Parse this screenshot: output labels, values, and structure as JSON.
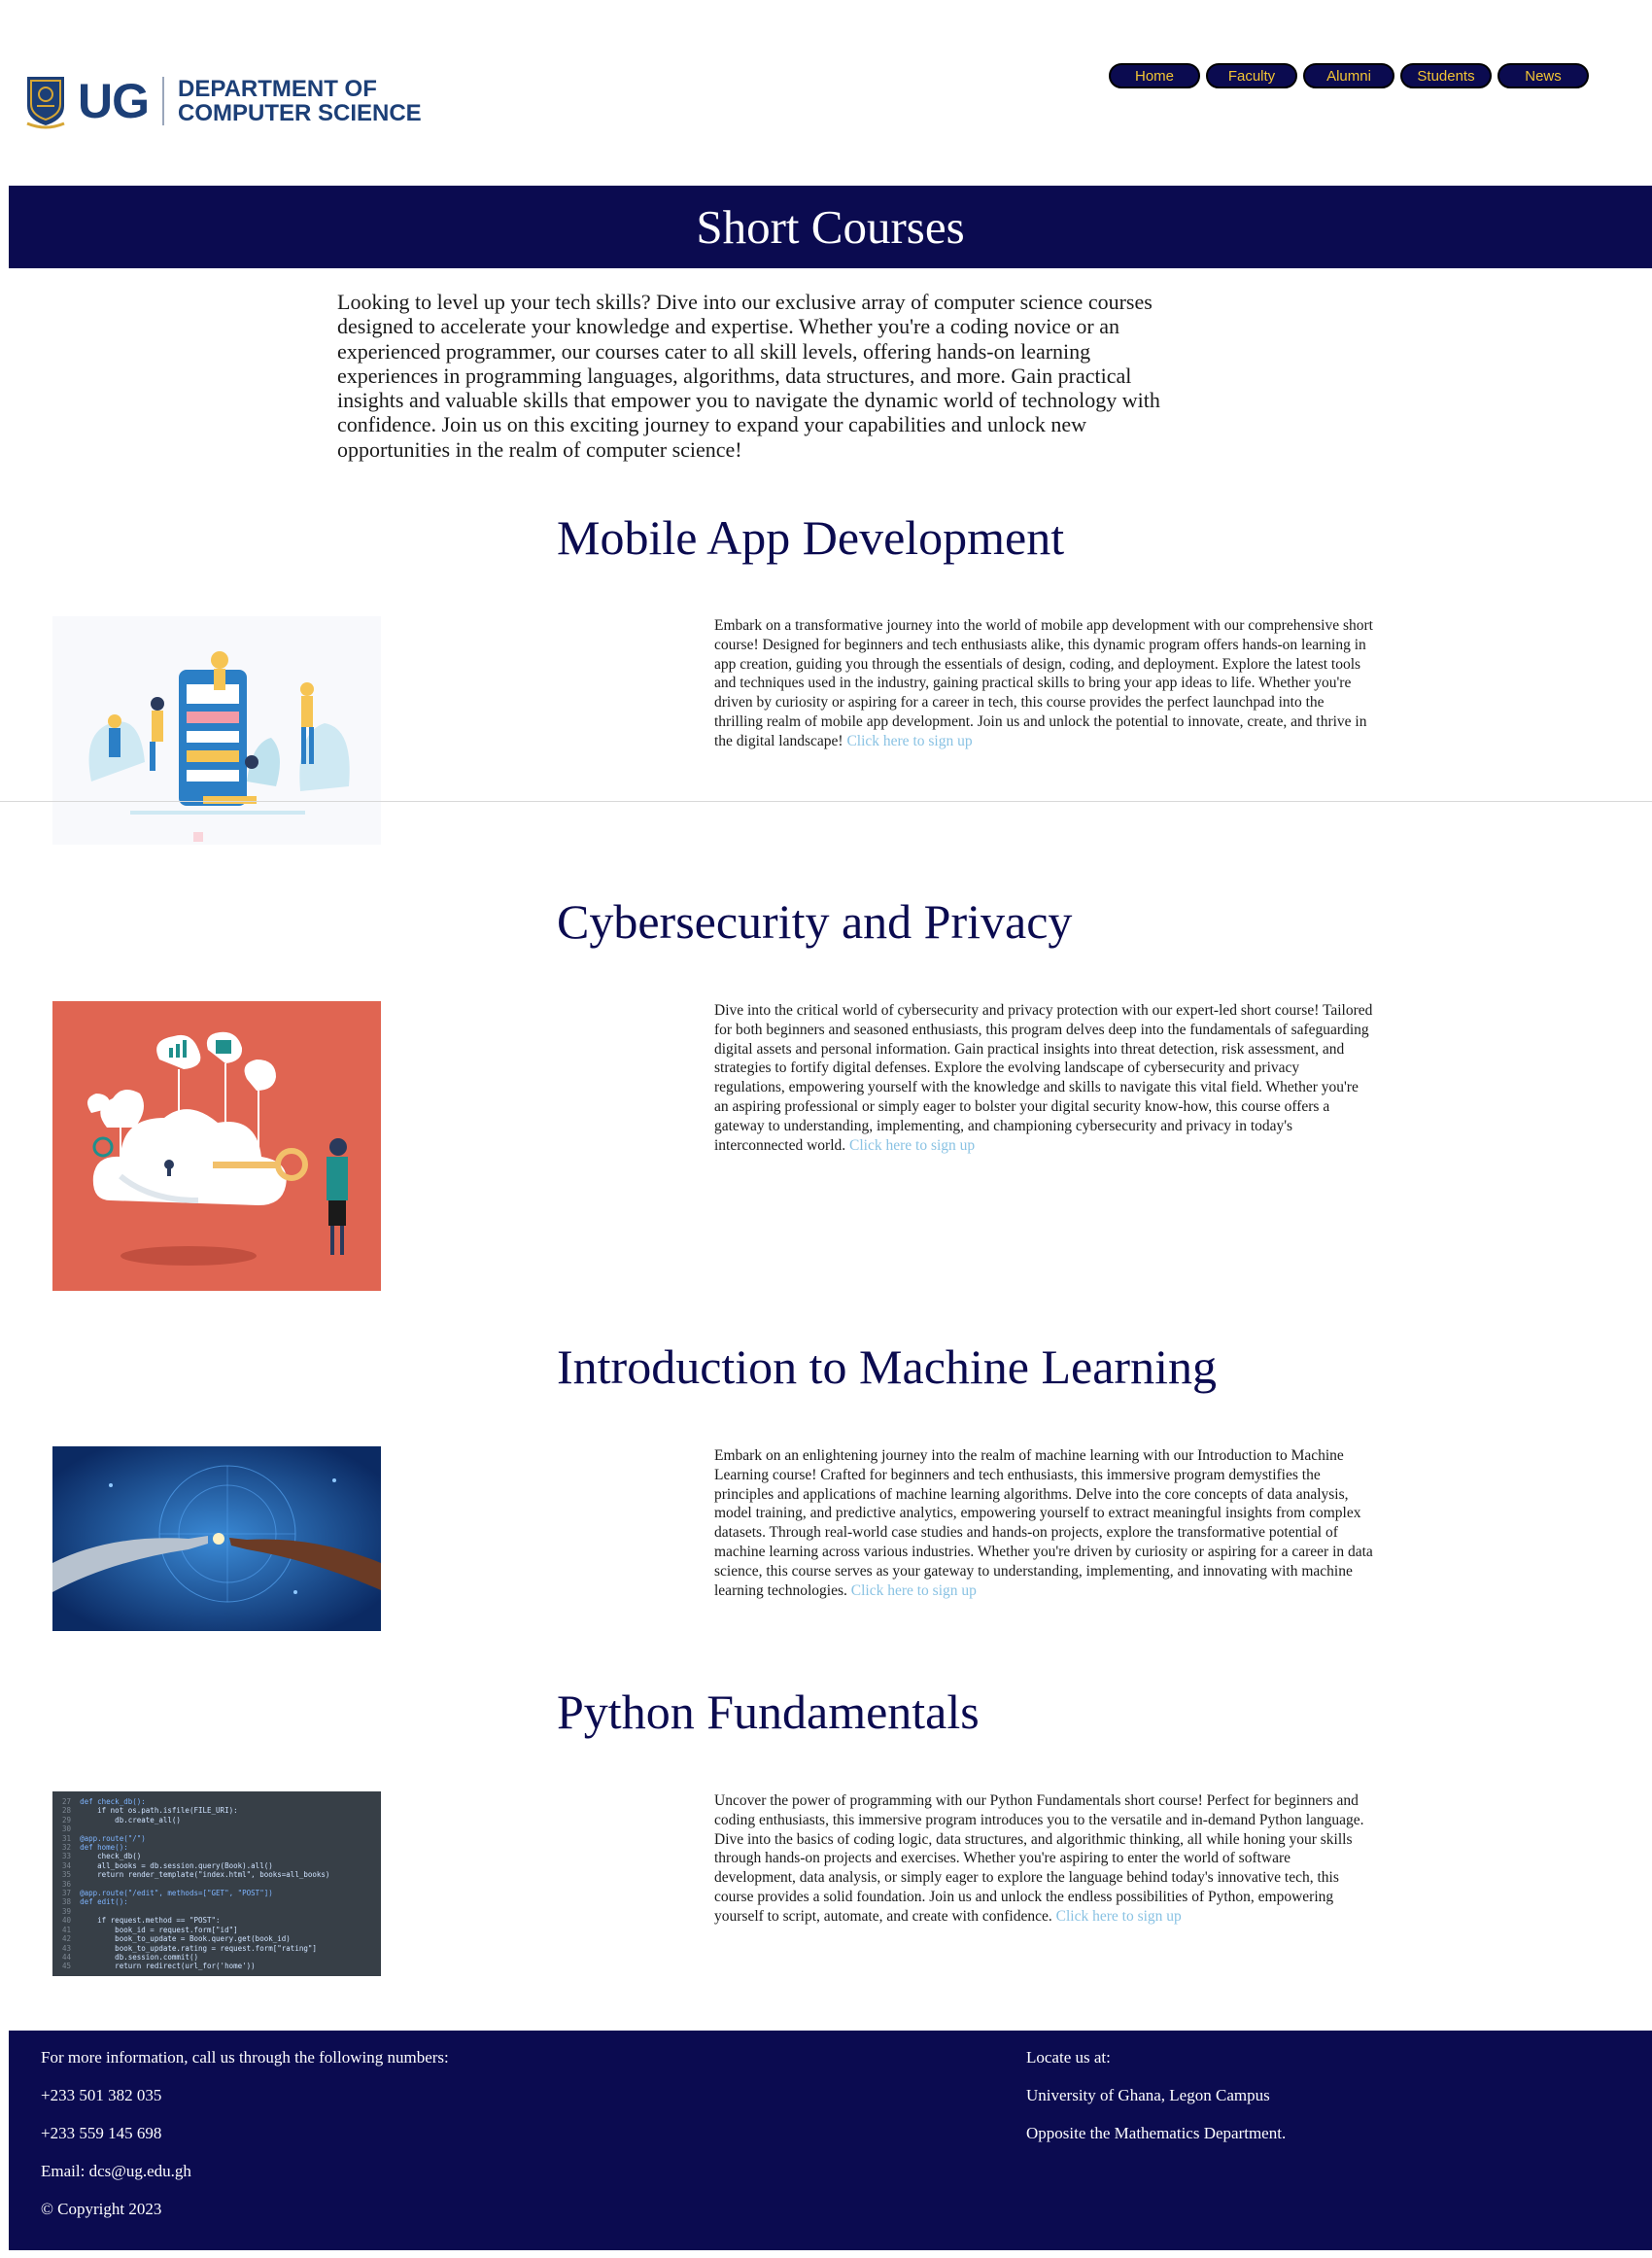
{
  "header": {
    "logo_short": "UG",
    "logo_line1": "DEPARTMENT OF",
    "logo_line2": "COMPUTER SCIENCE",
    "nav": [
      "Home",
      "Faculty",
      "Alumni",
      "Students",
      "News"
    ]
  },
  "banner": {
    "title": "Short Courses"
  },
  "intro": "Looking to level up your tech skills? Dive into our exclusive array of computer science courses designed to accelerate your knowledge and expertise. Whether you're a coding novice or an experienced programmer, our courses cater to all skill levels, offering hands-on learning experiences in programming languages, algorithms, data structures, and more. Gain practical insights and valuable skills that empower you to navigate the dynamic world of technology with confidence. Join us on this exciting journey to expand your capabilities and unlock new opportunities in the realm of computer science!",
  "courses": [
    {
      "title": "Mobile App Development",
      "description": "Embark on a transformative journey into the world of mobile app development with our comprehensive short course! Designed for beginners and tech enthusiasts alike, this dynamic program offers hands-on learning in app creation, guiding you through the essentials of design, coding, and deployment. Explore the latest tools and techniques used in the industry, gaining practical skills to bring your app ideas to life. Whether you're driven by curiosity or aspiring for a career in tech, this course provides the perfect launchpad into the thrilling realm of mobile app development. Join us and unlock the potential to innovate, create, and thrive in the digital landscape!",
      "link": "Click here to sign up"
    },
    {
      "title": "Cybersecurity and Privacy",
      "description": "Dive into the critical world of cybersecurity and privacy protection with our expert-led short course! Tailored for both beginners and seasoned enthusiasts, this program delves deep into the fundamentals of safeguarding digital assets and personal information. Gain practical insights into threat detection, risk assessment, and strategies to fortify digital defenses. Explore the evolving landscape of cybersecurity and privacy regulations, empowering yourself with the knowledge and skills to navigate this vital field. Whether you're an aspiring professional or simply eager to bolster your digital security know-how, this course offers a gateway to understanding, implementing, and championing cybersecurity and privacy in today's interconnected world.",
      "link": "Click here to sign up"
    },
    {
      "title": "Introduction to Machine Learning",
      "description": "Embark on an enlightening journey into the realm of machine learning with our Introduction to Machine Learning course! Crafted for beginners and tech enthusiasts, this immersive program demystifies the principles and applications of machine learning algorithms. Delve into the core concepts of data analysis, model training, and predictive analytics, empowering yourself to extract meaningful insights from complex datasets. Through real-world case studies and hands-on projects, explore the transformative potential of machine learning across various industries. Whether you're driven by curiosity or aspiring for a career in data science, this course serves as your gateway to understanding, implementing, and innovating with machine learning technologies.",
      "link": "Click here to sign up"
    },
    {
      "title": "Python Fundamentals",
      "description": "Uncover the power of programming with our Python Fundamentals short course! Perfect for beginners and coding enthusiasts, this immersive program introduces you to the versatile and in-demand Python language. Dive into the basics of coding logic, data structures, and algorithmic thinking, all while honing your skills through hands-on projects and exercises. Whether you're aspiring to enter the world of software development, data analysis, or simply eager to explore the language behind today's innovative tech, this course provides a solid foundation. Join us and unlock the endless possibilities of Python, empowering yourself to script, automate, and create with confidence.",
      "link": "Click here to sign up"
    }
  ],
  "code_image": {
    "lines": [
      "def check_db():",
      "    if not os.path.isfile(FILE_URI):",
      "        db.create_all()",
      "",
      "@app.route(\"/\")",
      "def home():",
      "    check_db()",
      "    all_books = db.session.query(Book).all()",
      "    return render_template(\"index.html\", books=all_books)",
      "",
      "@app.route(\"/edit\", methods=[\"GET\", \"POST\"])",
      "def edit():",
      "",
      "    if request.method == \"POST\":",
      "        book_id = request.form[\"id\"]",
      "        book_to_update = Book.query.get(book_id)",
      "        book_to_update.rating = request.form[\"rating\"]",
      "        db.session.commit()",
      "        return redirect(url_for('home'))"
    ]
  },
  "footer": {
    "info": "For more information, call us through the following numbers:",
    "phone1": "+233 501 382 035",
    "phone2": "+233 559 145 698",
    "email": "Email: dcs@ug.edu.gh",
    "copyright": "© Copyright 2023",
    "locate": "Locate us at:",
    "campus": "University of Ghana, Legon Campus",
    "landmark": "Opposite the Mathematics Department."
  },
  "colors": {
    "navy": "#0b0b50",
    "nav_text": "#f2c434",
    "link": "#89c2e3",
    "logo_blue": "#1c3f77"
  }
}
